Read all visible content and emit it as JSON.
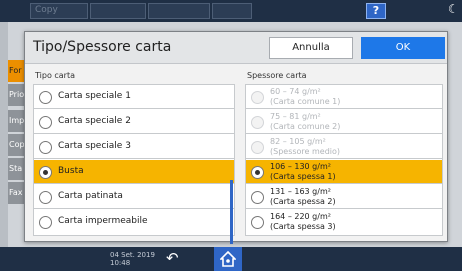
{
  "topbar": {
    "field_label": "Copy",
    "help_label": "?",
    "moon_glyph": "☾"
  },
  "background": {
    "tabs": [
      "For",
      "Prio",
      "Imp",
      "Cop",
      "Sta",
      "Fax"
    ]
  },
  "dialog": {
    "title": "Tipo/Spessore carta",
    "cancel_label": "Annulla",
    "ok_label": "OK",
    "left_header": "Tipo carta",
    "right_header": "Spessore carta",
    "paper_types": [
      {
        "label": "Carta speciale 1",
        "selected": false
      },
      {
        "label": "Carta speciale 2",
        "selected": false
      },
      {
        "label": "Carta speciale 3",
        "selected": false
      },
      {
        "label": "Busta",
        "selected": true
      },
      {
        "label": "Carta patinata",
        "selected": false
      },
      {
        "label": "Carta impermeabile",
        "selected": false
      }
    ],
    "thickness": [
      {
        "range": "60 – 74 g/m²",
        "name": "(Carta comune 1)",
        "enabled": false,
        "selected": false
      },
      {
        "range": "75 – 81 g/m²",
        "name": "(Carta comune 2)",
        "enabled": false,
        "selected": false
      },
      {
        "range": "82 – 105 g/m²",
        "name": "(Spessore medio)",
        "enabled": false,
        "selected": false
      },
      {
        "range": "106 – 130 g/m²",
        "name": "(Carta spessa 1)",
        "enabled": true,
        "selected": true
      },
      {
        "range": "131 – 163 g/m²",
        "name": "(Carta spessa 2)",
        "enabled": true,
        "selected": false
      },
      {
        "range": "164 – 220 g/m²",
        "name": "(Carta spessa 3)",
        "enabled": true,
        "selected": false
      }
    ]
  },
  "bottombar": {
    "date": "04 Set. 2019",
    "time": "10:48",
    "back_glyph": "↶"
  },
  "colors": {
    "selected": "#f6b400",
    "accent": "#1e78e8",
    "topbar": "#1f2f45"
  }
}
